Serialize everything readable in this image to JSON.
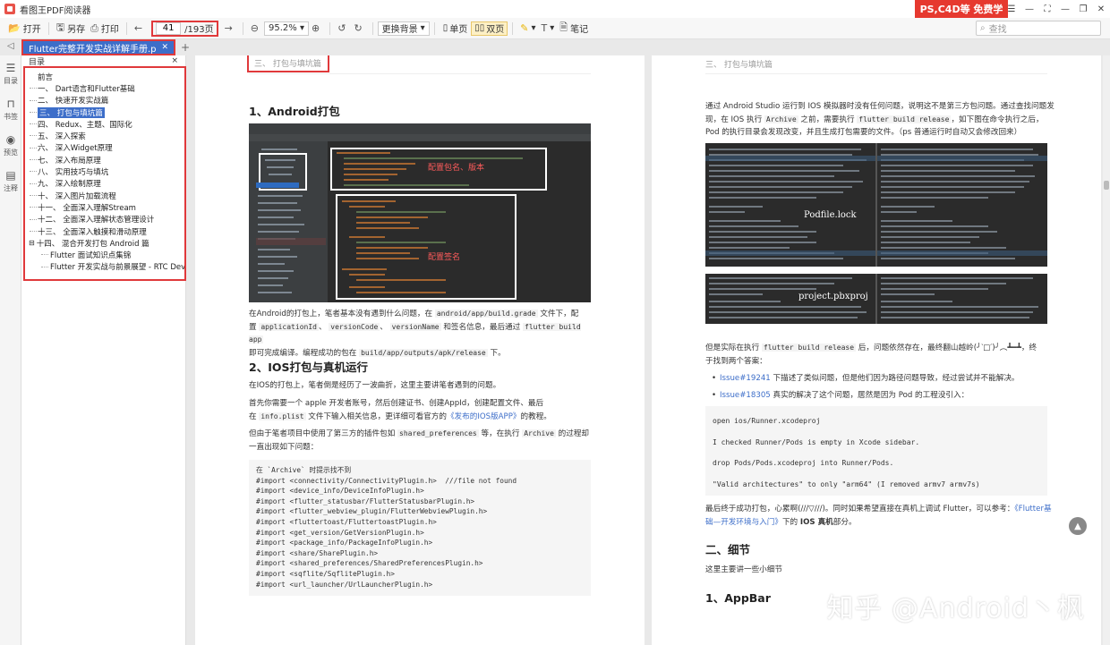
{
  "app": {
    "title": "看图王PDF阅读器",
    "promo": "PS,C4D等 免费学"
  },
  "window_controls": [
    "☰",
    "—",
    "⛶",
    "—",
    "❐",
    "✕"
  ],
  "toolbar": {
    "open": "打开",
    "save_as": "另存",
    "print": "打印",
    "page_current": "41",
    "page_total": "/193页",
    "zoom": "95.2%",
    "background": "更换背景",
    "single_page": "单页",
    "double_page": "双页",
    "notes": "笔记",
    "search_placeholder": "查找"
  },
  "tab": {
    "label": "Flutter完整开发实战详解手册.p"
  },
  "rail": {
    "toc": "目录",
    "bookmark": "书签",
    "preview": "预览",
    "annotate": "注释"
  },
  "toc": {
    "header": "目录",
    "items": [
      "前言",
      "一、 Dart语言和Flutter基础",
      "二、 快速开发实战篇",
      "三、 打包与填坑篇",
      "四、 Redux、主题、国际化",
      "五、 深入探索",
      "六、 深入Widget原理",
      "七、 深入布局原理",
      "八、 实用技巧与填坑",
      "九、 深入绘制原理",
      "十、 深入图片加载流程",
      "十一、 全面深入理解Stream",
      "十二、 全面深入理解状态管理设计",
      "十三、 全面深入触摸和滑动原理",
      "十四、 混合开发打包 Android 篇",
      "Flutter 面试知识点集锦",
      "Flutter 开发实战与前景展望 - RTC Dev M"
    ]
  },
  "page_left": {
    "running_head": "三、 打包与填坑篇",
    "h_android": "1、Android打包",
    "shot_label_1": "配置包名、版本",
    "shot_label_2": "配置签名",
    "p_android_1": "在Android的打包上，笔者基本没有遇到什么问题，在",
    "code_gradle": "android/app/build.grade",
    "p_android_2": "文件下，配",
    "p_android_3": "置",
    "code_appid": "applicationId",
    "code_vcode": "versionCode",
    "code_vname": "versionName",
    "p_android_4": "和签名信息，最后通过",
    "code_build": "flutter build app",
    "p_android_5": "即可完成编译。编程成功的包在",
    "code_out": "build/app/outputs/apk/release",
    "p_android_6": "下。",
    "h_ios": "2、IOS打包与真机运行",
    "p_ios_1": "在IOS的打包上，笔者倒是经历了一波曲折，这里主要讲笔者遇到的问题。",
    "p_ios_2a": "首先你需要一个 apple 开发者账号，然后创建证书、创建AppId，创建配置文件、最后",
    "p_ios_2b": "在",
    "code_plist": "info.plist",
    "p_ios_2c": "文件下输入相关信息，更详细可看官方的",
    "link_ios": "《发布的IOS版APP》",
    "p_ios_2d": "的教程。",
    "p_ios_3a": "但由于笔者项目中使用了第三方的插件包如",
    "code_shared": "shared_preferences",
    "p_ios_3b": "等，在执行",
    "code_archive": "Archive",
    "p_ios_3c": "的过程却",
    "p_ios_3d": "一直出现如下问题：",
    "code_lines": [
      "在 `Archive` 时提示找不到",
      "#import <connectivity/ConnectivityPlugin.h>  ///file not found",
      "#import <device_info/DeviceInfoPlugin.h>",
      "#import <flutter_statusbar/FlutterStatusbarPlugin.h>",
      "#import <flutter_webview_plugin/FlutterWebviewPlugin.h>",
      "#import <fluttertoast/FluttertoastPlugin.h>",
      "#import <get_version/GetVersionPlugin.h>",
      "#import <package_info/PackageInfoPlugin.h>",
      "#import <share/SharePlugin.h>",
      "#import <shared_preferences/SharedPreferencesPlugin.h>",
      "#import <sqflite/SqflitePlugin.h>",
      "#import <url_launcher/UrlLauncherPlugin.h>"
    ]
  },
  "page_right": {
    "running_head": "三、 打包与填坑篇",
    "p1a": "通过 Android Studio 运行到 IOS 模拟器时没有任何问题，说明这不是第三方包问题。通过查找问题发",
    "p1b": "现，在 IOS 执行",
    "code_archive": "Archive",
    "p1c": "之前，需要执行",
    "code_fbr": "flutter build release",
    "p1d": "，如下图在命令执行之后，",
    "p1e": "Pod 的执行目录会发现改变，并且生成打包需要的文件。（ps 普通运行时自动又会修改回来）",
    "img1_label": "Podfile.lock",
    "img2_label": "project.pbxproj",
    "p2a": "但是实际在执行",
    "code_fbr2": "flutter build release",
    "p2b": "后，问题依然存在，最终翻山越岭(╯‵□′)╯︵┻━┻，终",
    "p2c": "于找到两个答案：",
    "issue1_link": "Issue#19241",
    "issue1_text": "下描述了类似问题，但是他们因为路径问题导致，经过尝试并不能解决。",
    "issue2_link": "Issue#18305",
    "issue2_text": "真实的解决了这个问题，居然是因为 Pod 的工程没引入：",
    "code_lines": [
      "open ios/Runner.xcodeproj",
      "I checked Runner/Pods is empty in Xcode sidebar.",
      "drop Pods/Pods.xcodeproj into Runner/Pods.",
      "\"Valid architectures\" to only \"arm64\" (I removed armv7 armv7s)"
    ],
    "p3a": "最后终于成功打包，心累啊(///▽///)。同时如果希望直接在真机上调试 Flutter，可以参考：",
    "p3_link": "《Flutter基",
    "p3_link2": "础—开发环境与入门》",
    "p3b": "下的",
    "p3_bold": "IOS 真机",
    "p3c": "部分。",
    "h_detail": "二、细节",
    "p4": "这里主要讲一些小细节",
    "h_appbar": "1、AppBar"
  },
  "watermark": "知乎 @Android丶枫",
  "colors": {
    "accent": "#3d6ec9",
    "highlight_box": "#e0393b",
    "promo": "#e6392f"
  }
}
